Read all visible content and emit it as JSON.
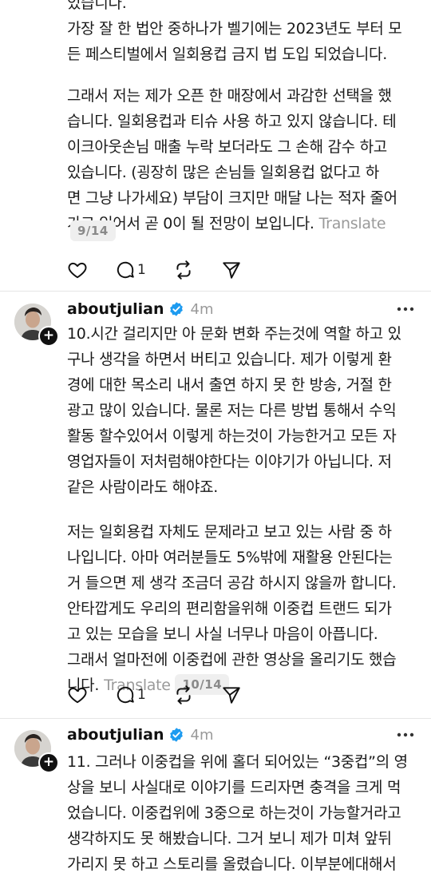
{
  "post1": {
    "lines": [
      "있습니다.",
      "가장 잘 한 법안 중하나가 벨기에는 2023년도 부터 모",
      "든 페스티벌에서 일회용컵 금지 법 도입 되었습니다.",
      "",
      "그래서 저는 제가 오픈 한 매장에서 과감한 선택을 했",
      "습니다. 일회용컵과 티슈 사용 하고 있지 않습니다. 테",
      "이크아웃손님 매출 누락 보더라도 그 손해 감수 하고",
      "있습니다. (굉장히 많은 손님들 일회용컵 없다고 하",
      "면 그냥 나가세요) 부담이 크지만 매달 나는 적자 줄어",
      "가고 있어서 곧 0이 될 전망이 보입니다."
    ],
    "translate": "Translate",
    "page": "9/14",
    "reply_count": "1"
  },
  "post2": {
    "username": "aboutjulian",
    "time": "4m",
    "lines": [
      "10.시간 걸리지만 아 문화 변화 주는것에 역할 하고 있",
      "구나 생각을 하면서 버티고 있습니다. 제가 이렇게 환",
      "경에 대한 목소리 내서 출연 하지 못 한 방송, 거절 한",
      "광고 많이 있습니다. 물론 저는 다른 방법 통해서 수익",
      "활동 할수있어서 이렇게 하는것이 가능한거고 모든 자",
      "영업자들이 저처럼해야한다는 이야기가 아닙니다. 저",
      "같은 사람이라도 해야죠.",
      "",
      "저는 일회용컵 자체도 문제라고 보고 있는 사람 중 하",
      "나입니다. 아마 여러분들도 5%밖에 재활용 안된다는",
      "거 들으면 제 생각 조금더 공감 하시지 않을까 합니다.",
      "안타깝게도 우리의 편리함을위해 이중컵 트랜드 되가",
      "고 있는 모습을 보니 사실 너무나 마음이 아픕니다.",
      "그래서 얼마전에 이중컵에 관한 영상을 올리기도 했습",
      "니다."
    ],
    "translate": "Translate",
    "page": "10/14",
    "reply_count": "1"
  },
  "post3": {
    "username": "aboutjulian",
    "time": "4m",
    "lines": [
      "11. 그러나 이중컵을 위에 홀더 되어있는 “3중컵”의 영",
      "상을 보니 사실대로 이야기를 드리자면 충격을 크게 먹",
      "었습니다. 이중컵위에 3중으로 하는것이 가능할거라고",
      "생각하지도 못 해봤습니다. 그거 보니 제가 미쳐 앞뒤",
      "가리지 못 하고 스토리를 올렸습니다. 이부분에대해서"
    ]
  },
  "icons": {
    "like": "heart-icon",
    "reply": "comment-icon",
    "repost": "repost-icon",
    "share": "send-icon",
    "verified": "verified-badge-icon",
    "more": "more-options-icon"
  },
  "colors": {
    "verified": "#1d9bf0",
    "muted": "#9a9a9a"
  }
}
